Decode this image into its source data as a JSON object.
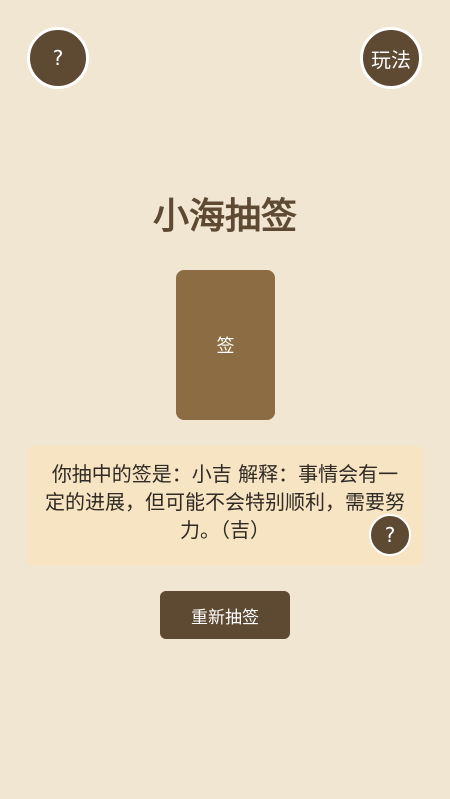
{
  "header": {
    "help_label": "?",
    "rules_label": "玩法"
  },
  "main": {
    "title": "小海抽签",
    "card_label": "签",
    "result_text": "你抽中的签是：小吉 解释：事情会有一定的进展，但可能不会特别顺利，需要努力。（吉）",
    "result_help_label": "?",
    "redraw_label": "重新抽签"
  },
  "colors": {
    "background": "#f1e6d2",
    "button": "#5e4a33",
    "card": "#8b6c43",
    "result_bg": "#f7e4c3"
  }
}
